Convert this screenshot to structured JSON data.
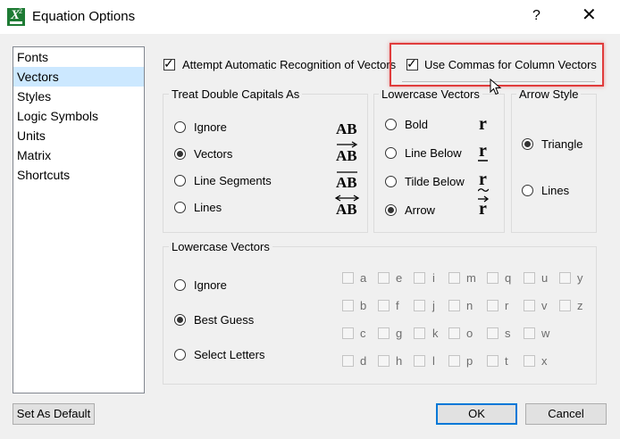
{
  "window": {
    "title": "Equation Options",
    "help_glyph": "?",
    "close_glyph": "✕",
    "app_icon_letter": "X",
    "app_icon_sup": "2"
  },
  "sidebar": {
    "items": [
      "Fonts",
      "Vectors",
      "Styles",
      "Logic Symbols",
      "Units",
      "Matrix",
      "Shortcuts"
    ],
    "selected": "Vectors"
  },
  "options": {
    "auto_recognition": "Attempt Automatic Recognition of Vectors",
    "use_commas": "Use Commas for Column Vectors"
  },
  "double_capitals": {
    "title": "Treat Double Capitals As",
    "options": [
      "Ignore",
      "Vectors",
      "Line Segments",
      "Lines"
    ],
    "selected": "Vectors",
    "glyph": "AB"
  },
  "lowercase_style": {
    "title": "Lowercase Vectors",
    "options": [
      "Bold",
      "Line Below",
      "Tilde Below",
      "Arrow"
    ],
    "selected": "Arrow",
    "glyph": "r"
  },
  "arrow_style": {
    "title": "Arrow Style",
    "options": [
      "Triangle",
      "Lines"
    ],
    "selected": "Triangle"
  },
  "lowercase_mode": {
    "title": "Lowercase Vectors",
    "options": [
      "Ignore",
      "Best Guess",
      "Select Letters"
    ],
    "selected": "Best Guess",
    "letters": [
      [
        "a",
        "e",
        "i",
        "m",
        "q",
        "u",
        "y"
      ],
      [
        "b",
        "f",
        "j",
        "n",
        "r",
        "v",
        "z"
      ],
      [
        "c",
        "g",
        "k",
        "o",
        "s",
        "w"
      ],
      [
        "d",
        "h",
        "l",
        "p",
        "t",
        "x"
      ]
    ]
  },
  "buttons": {
    "set_default": "Set As Default",
    "ok": "OK",
    "cancel": "Cancel"
  },
  "colors": {
    "selection": "#cce8ff",
    "highlight": "#e03c3c",
    "default_button_border": "#0078d7"
  }
}
